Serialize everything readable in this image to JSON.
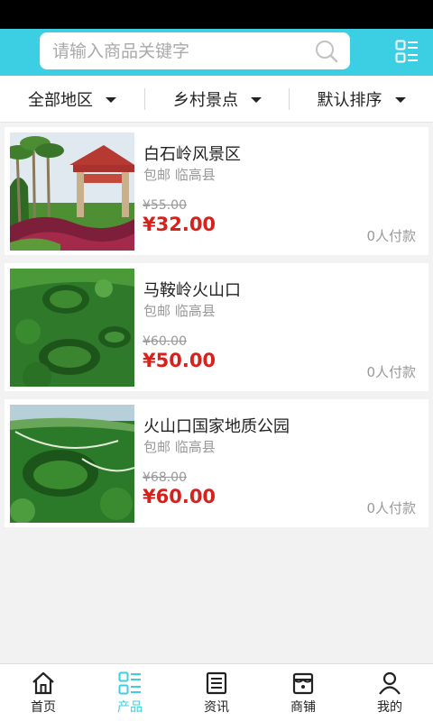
{
  "search": {
    "placeholder": "请输入商品关键字",
    "value": ""
  },
  "filters": [
    {
      "label": "全部地区"
    },
    {
      "label": "乡村景点"
    },
    {
      "label": "默认排序"
    }
  ],
  "products": [
    {
      "title": "白石岭风景区",
      "shipping": "包邮",
      "location": "临高县",
      "original_price": "¥55.00",
      "price": "¥32.00",
      "sales": "0人付款"
    },
    {
      "title": "马鞍岭火山口",
      "shipping": "包邮",
      "location": "临高县",
      "original_price": "¥60.00",
      "price": "¥50.00",
      "sales": "0人付款"
    },
    {
      "title": "火山口国家地质公园",
      "shipping": "包邮",
      "location": "临高县",
      "original_price": "¥68.00",
      "price": "¥60.00",
      "sales": "0人付款"
    }
  ],
  "tabs": [
    {
      "label": "首页",
      "icon": "home-icon"
    },
    {
      "label": "产品",
      "icon": "products-grid-icon",
      "active": true
    },
    {
      "label": "资讯",
      "icon": "news-icon"
    },
    {
      "label": "商铺",
      "icon": "store-icon"
    },
    {
      "label": "我的",
      "icon": "user-icon"
    }
  ],
  "colors": {
    "accent": "#3ccfe3",
    "price": "#d9211b",
    "muted": "#999999"
  }
}
